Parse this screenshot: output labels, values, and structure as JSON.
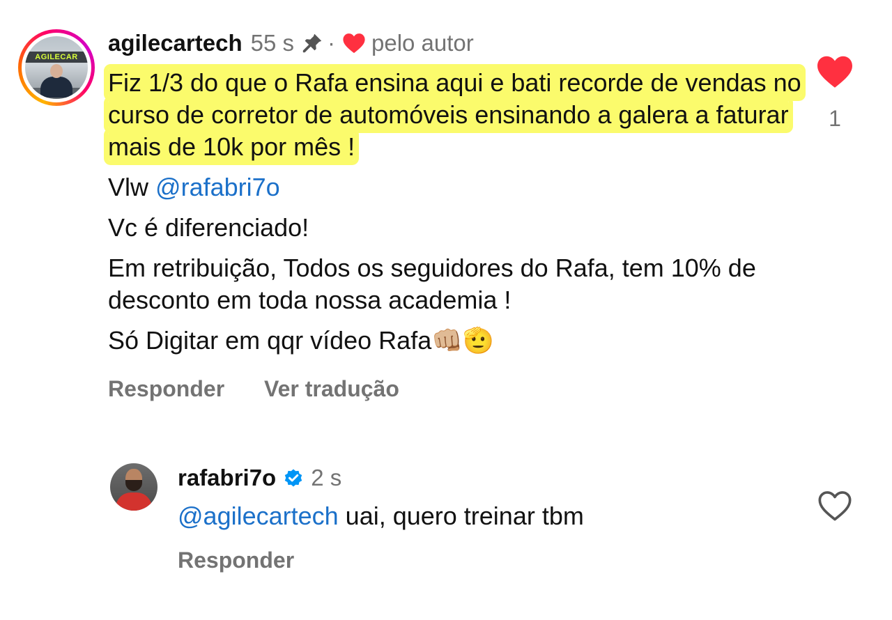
{
  "comment": {
    "avatar_text": "AGILECAR",
    "username": "agilecartech",
    "time": "55 s",
    "separator": "·",
    "liked_by_author": "pelo autor",
    "highlighted_text": "Fiz 1/3 do que o Rafa ensina aqui e bati recorde de vendas no curso de corretor de automóveis ensinando a galera a faturar mais de 10k por mês !",
    "line_vlw": "Vlw",
    "mention": "@rafabri7o",
    "line_diff": "Vc é diferenciado!",
    "line_retrib": "Em retribuição, Todos os seguidores do Rafa, tem 10% de desconto em toda nossa academia !",
    "line_digitar": "Só Digitar em qqr vídeo Rafa",
    "emojis": "👊🏼🫡",
    "like_count": "1",
    "reply_label": "Responder",
    "translate_label": "Ver tradução",
    "colors": {
      "heart": "#ff3040",
      "mention": "#1b70c9",
      "highlight": "#fbfb6c"
    },
    "icons": [
      "pin-icon",
      "heart-icon",
      "heart-filled-icon"
    ]
  },
  "reply": {
    "username": "rafabri7o",
    "time": "2 s",
    "mention": "@agilecartech",
    "text": " uai, quero treinar tbm",
    "reply_label": "Responder",
    "colors": {
      "verified": "#0095f6"
    },
    "icons": [
      "verified-badge-icon",
      "heart-outline-icon"
    ]
  }
}
